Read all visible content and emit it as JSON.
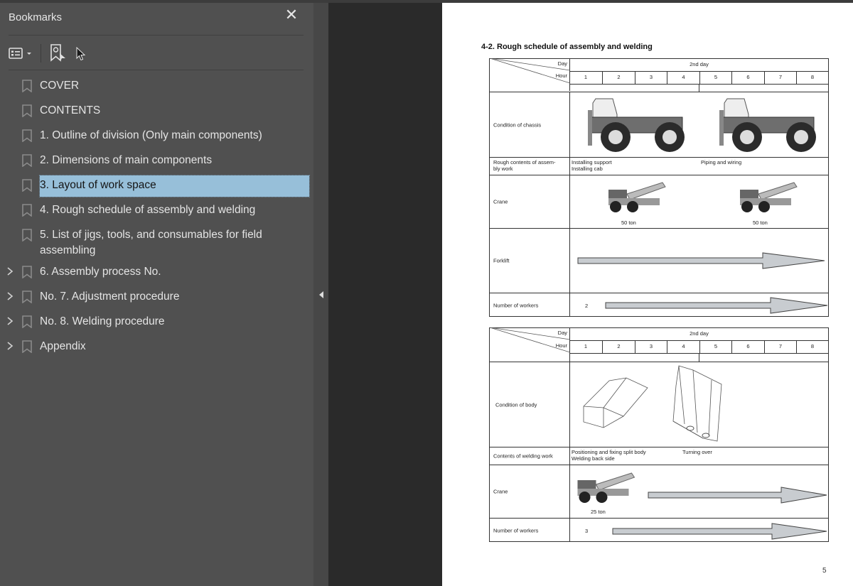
{
  "sidebar": {
    "title": "Bookmarks",
    "close_label": "✕",
    "tools": [
      {
        "name": "options-menu",
        "icon": "list-options-icon"
      },
      {
        "name": "find-current-bookmark",
        "icon": "bookmark-search-icon"
      }
    ],
    "items": [
      {
        "label": "COVER",
        "expandable": false,
        "selected": false
      },
      {
        "label": "CONTENTS",
        "expandable": false,
        "selected": false
      },
      {
        "label": "1. Outline of division (Only main components)",
        "expandable": false,
        "selected": false
      },
      {
        "label": "2. Dimensions of main components",
        "expandable": false,
        "selected": false
      },
      {
        "label": "3. Layout of work space",
        "expandable": false,
        "selected": true
      },
      {
        "label": "4. Rough schedule of assembly and welding",
        "expandable": false,
        "selected": false
      },
      {
        "label": "5. List of jigs, tools, and consumables for field assembling",
        "expandable": false,
        "selected": false
      },
      {
        "label": "6. Assembly process No.",
        "expandable": true,
        "selected": false
      },
      {
        "label": "No. 7. Adjustment procedure",
        "expandable": true,
        "selected": false
      },
      {
        "label": "No. 8. Welding procedure",
        "expandable": true,
        "selected": false
      },
      {
        "label": "Appendix",
        "expandable": true,
        "selected": false
      }
    ]
  },
  "document": {
    "section_title": "4-2.  Rough schedule of assembly and welding",
    "page_number": "5",
    "tables": [
      {
        "header": {
          "day_label": "Day",
          "hour_label": "Hour",
          "day_value": "2nd day",
          "hours": [
            "1",
            "2",
            "3",
            "4",
            "5",
            "6",
            "7",
            "8"
          ]
        },
        "rows": {
          "condition": {
            "label": "Condition of chassis",
            "images": [
              "dump-truck-chassis-image",
              "dump-truck-chassis-image"
            ]
          },
          "contents": {
            "label": "Rough contents of assem-\nbly work",
            "left": "Installing support\nInstalling cab",
            "right": "Piping and wiring"
          },
          "crane": {
            "label": "Crane",
            "capacities": [
              "50 ton",
              "50 ton"
            ]
          },
          "forklift": {
            "label": "Forklift"
          },
          "workers": {
            "label": "Number of workers",
            "count": "2"
          }
        }
      },
      {
        "header": {
          "day_label": "Day",
          "hour_label": "Hour",
          "day_value": "2nd day",
          "hours": [
            "1",
            "2",
            "3",
            "4",
            "5",
            "6",
            "7",
            "8"
          ]
        },
        "rows": {
          "condition": {
            "label": "Condition of body",
            "images": [
              "split-body-image",
              "body-turned-over-image"
            ]
          },
          "contents": {
            "label": "Contents of welding work",
            "left": "Positioning and fixing split body\nWelding back side",
            "right": "Turning over"
          },
          "crane": {
            "label": "Crane",
            "capacities": [
              "25 ton"
            ]
          },
          "workers": {
            "label": "Number of workers",
            "count": "3"
          }
        }
      }
    ]
  },
  "colors": {
    "sidebar_bg": "#505050",
    "viewer_bg": "#2a2a2a",
    "selection": "#97bfd9",
    "arrow_fill": "#c8ccd0"
  }
}
